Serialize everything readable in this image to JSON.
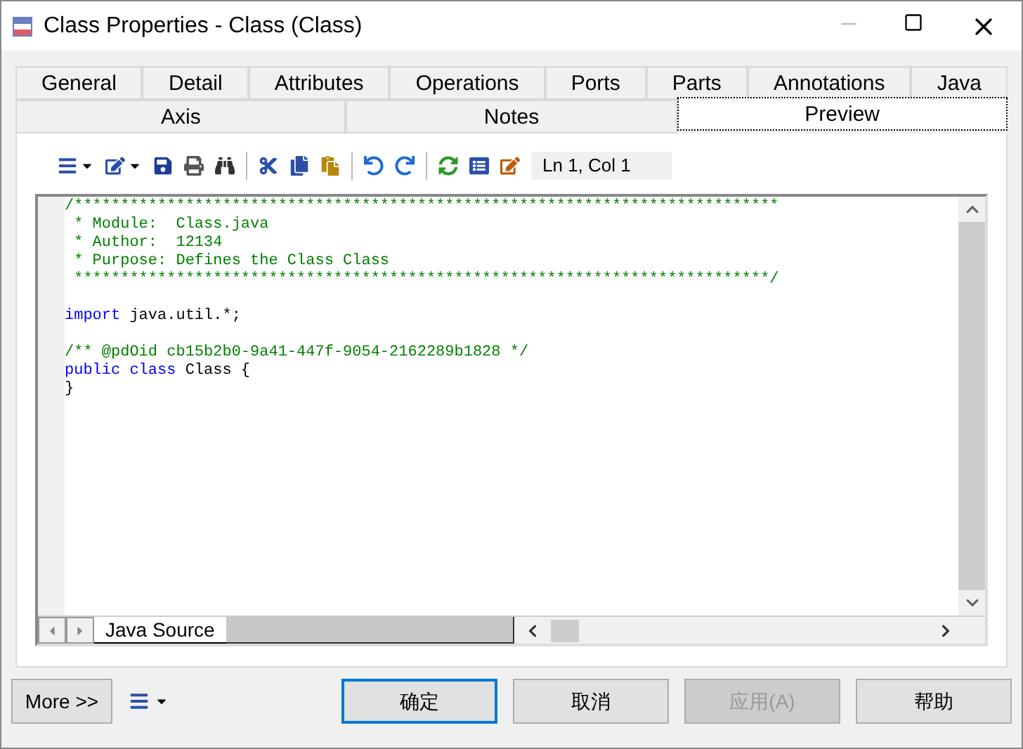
{
  "window": {
    "title": "Class Properties - Class (Class)"
  },
  "tabs_row_1": [
    {
      "label": "General",
      "selected": false
    },
    {
      "label": "Detail",
      "selected": false
    },
    {
      "label": "Attributes",
      "selected": false
    },
    {
      "label": "Operations",
      "selected": false
    },
    {
      "label": "Ports",
      "selected": false
    },
    {
      "label": "Parts",
      "selected": false
    },
    {
      "label": "Annotations",
      "selected": false
    },
    {
      "label": "Java",
      "selected": false
    }
  ],
  "tabs_row_2": [
    {
      "label": "Axis",
      "selected": false
    },
    {
      "label": "Notes",
      "selected": false
    },
    {
      "label": "Preview",
      "selected": true
    }
  ],
  "toolbar": {
    "position": "Ln 1, Col 1"
  },
  "code_lines": [
    {
      "gap_before": false,
      "segments": [
        {
          "kind": "comment",
          "text": "/****************************************************************************"
        }
      ]
    },
    {
      "gap_before": false,
      "segments": [
        {
          "kind": "comment",
          "text": " * Module:  Class.java"
        }
      ]
    },
    {
      "gap_before": false,
      "segments": [
        {
          "kind": "comment",
          "text": " * Author:  12134"
        }
      ]
    },
    {
      "gap_before": false,
      "segments": [
        {
          "kind": "comment",
          "text": " * Purpose: Defines the Class Class"
        }
      ]
    },
    {
      "gap_before": false,
      "segments": [
        {
          "kind": "comment",
          "text": " ***************************************************************************/"
        }
      ]
    },
    {
      "gap_before": true,
      "segments": [
        {
          "kind": "keyword",
          "text": "import"
        },
        {
          "kind": "plain",
          "text": " java.util.*;"
        }
      ]
    },
    {
      "gap_before": true,
      "segments": [
        {
          "kind": "comment",
          "text": "/** @pdOid cb15b2b0-9a41-447f-9054-2162289b1828 */"
        }
      ]
    },
    {
      "gap_before": false,
      "segments": [
        {
          "kind": "keyword",
          "text": "public"
        },
        {
          "kind": "keyword",
          "text": " class"
        },
        {
          "kind": "plain",
          "text": " Class {"
        }
      ]
    },
    {
      "gap_before": false,
      "segments": [
        {
          "kind": "plain",
          "text": "}"
        }
      ]
    }
  ],
  "source_tabs": [
    {
      "label": "Java Source",
      "selected": true
    }
  ],
  "footer": {
    "more_button": "More >>",
    "buttons": [
      {
        "label": "确定",
        "kind": "default",
        "disabled": false
      },
      {
        "label": "取消",
        "kind": "normal",
        "disabled": false
      },
      {
        "label": "应用(A)",
        "kind": "normal",
        "disabled": true
      },
      {
        "label": "帮助",
        "kind": "normal",
        "disabled": false
      }
    ]
  }
}
